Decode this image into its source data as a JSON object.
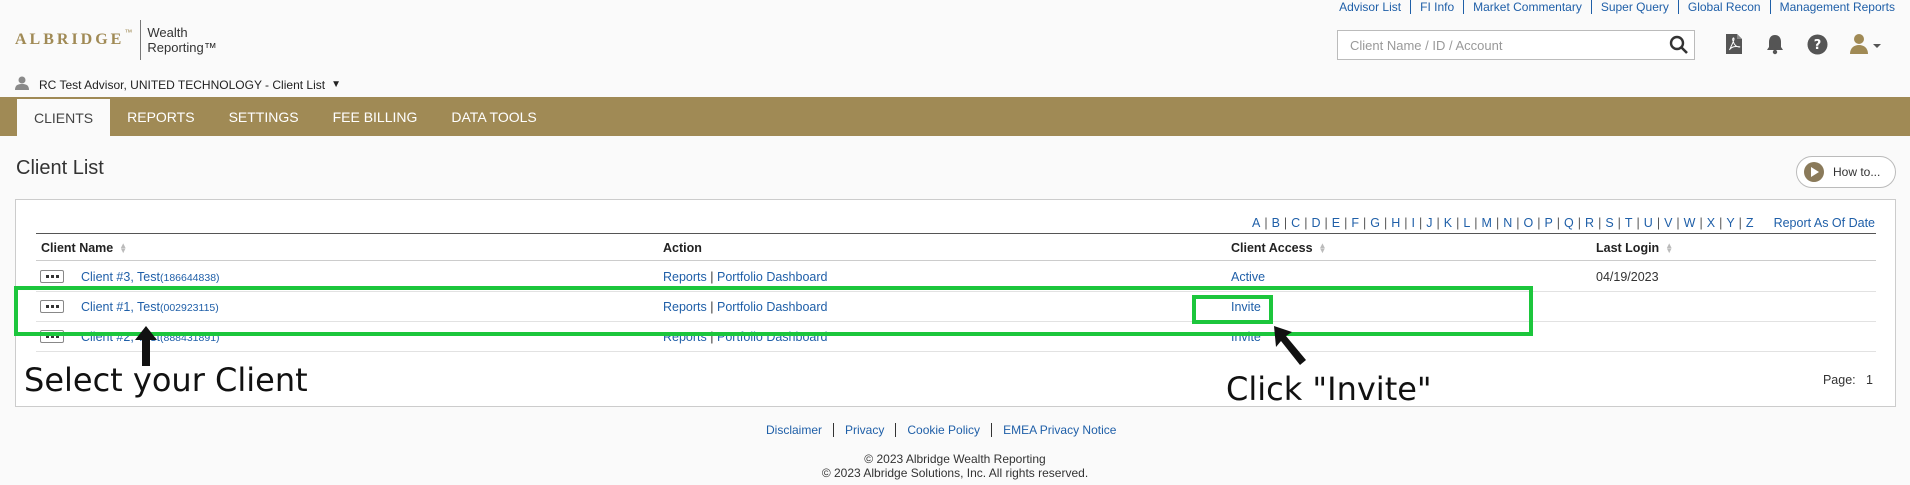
{
  "top_links": [
    "Advisor List",
    "FI Info",
    "Market Commentary",
    "Super Query",
    "Global Recon",
    "Management Reports"
  ],
  "logo": {
    "word": "ALBRIDGE",
    "tm": "™",
    "sub1": "Wealth",
    "sub2": "Reporting™"
  },
  "search": {
    "placeholder": "Client Name / ID / Account"
  },
  "header_icons": [
    "pdf-icon",
    "bell-icon",
    "help-icon",
    "user-icon"
  ],
  "advisor": {
    "label": "RC Test Advisor, UNITED TECHNOLOGY - Client List"
  },
  "nav": {
    "tabs": [
      "CLIENTS",
      "REPORTS",
      "SETTINGS",
      "FEE BILLING",
      "DATA TOOLS"
    ],
    "active": "CLIENTS"
  },
  "page_title": "Client List",
  "howto": {
    "label": "How to..."
  },
  "alphabet": [
    "A",
    "B",
    "C",
    "D",
    "E",
    "F",
    "G",
    "H",
    "I",
    "J",
    "K",
    "L",
    "M",
    "N",
    "O",
    "P",
    "Q",
    "R",
    "S",
    "T",
    "U",
    "V",
    "W",
    "X",
    "Y",
    "Z"
  ],
  "report_as_of": "Report As Of Date",
  "table": {
    "headers": {
      "client_name": "Client Name",
      "action": "Action",
      "client_access": "Client Access",
      "last_login": "Last Login"
    },
    "rows": [
      {
        "name": "Client #3, Test",
        "id": "(186644838)",
        "reports": "Reports",
        "sep": "|",
        "dashboard": "Portfolio Dashboard",
        "access": "Active",
        "last_login": "04/19/2023"
      },
      {
        "name": "Client #1, Test",
        "id": "(002923115)",
        "reports": "Reports",
        "sep": "|",
        "dashboard": "Portfolio Dashboard",
        "access": "Invite",
        "last_login": ""
      },
      {
        "name": "Client #2, Test",
        "id": "(888431891)",
        "reports": "Reports",
        "sep": "|",
        "dashboard": "Portfolio Dashboard",
        "access": "Invite",
        "last_login": ""
      }
    ]
  },
  "page": {
    "label": "Page:",
    "number": "1"
  },
  "annotations": {
    "select": "Select your Client",
    "click": "Click \"Invite\""
  },
  "footer": {
    "links": [
      "Disclaimer",
      "Privacy",
      "Cookie Policy",
      "EMEA Privacy Notice"
    ],
    "copy1": "© 2023 Albridge Wealth Reporting",
    "copy2": "© 2023 Albridge Solutions, Inc. All rights reserved."
  },
  "colors": {
    "brand_gold": "#a08a55",
    "link_blue": "#1f5fa8",
    "highlight_green": "#1cc63c"
  }
}
